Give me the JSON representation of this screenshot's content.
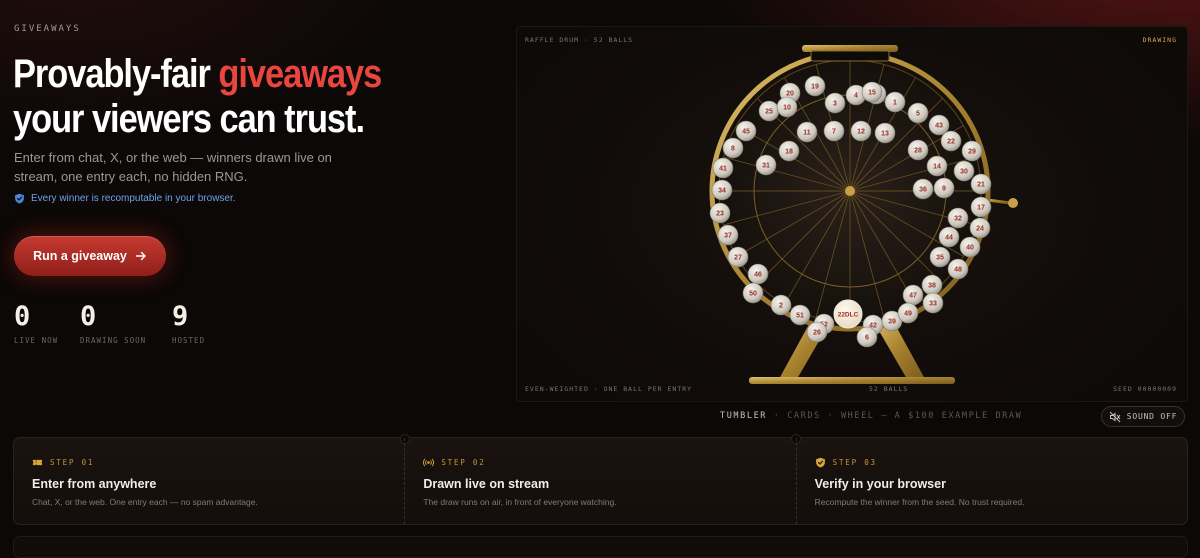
{
  "hero": {
    "eyebrow": "GIVEAWAYS",
    "headline_part1": "Provably-fair ",
    "headline_accent": "giveaways",
    "headline_part2": " your viewers can trust.",
    "subtitle": "Enter from chat, X, or the web — winners drawn live on stream, one entry each, no hidden RNG.",
    "verify_note": "Every winner is recomputable in your browser.",
    "verify_icon": "shield-check-icon",
    "cta_label": "Run a giveaway",
    "cta_icon": "arrow-right-icon",
    "stats": [
      {
        "value": "0",
        "label": "LIVE NOW"
      },
      {
        "value": "0",
        "label": "DRAWING SOON"
      },
      {
        "value": "9",
        "label": "HOSTED"
      }
    ]
  },
  "drum": {
    "top_left": "RAFFLE DRUM · 52 BALLS",
    "top_right": "DRAWING",
    "bottom_left": "EVEN-WEIGHTED · ONE BALL PER ENTRY",
    "bottom_center": "52 BALLS",
    "bottom_right": "SEED 00000009",
    "winner_label": "22DLC",
    "balls": [
      20,
      19,
      3,
      4,
      16,
      1,
      15,
      25,
      10,
      5,
      43,
      45,
      11,
      7,
      12,
      13,
      22,
      29,
      8,
      18,
      28,
      14,
      30,
      31,
      41,
      36,
      9,
      21,
      34,
      17,
      23,
      32,
      24,
      37,
      44,
      40,
      27,
      35,
      48,
      46,
      38,
      50,
      47,
      33,
      2,
      51,
      52,
      42,
      39,
      49,
      26,
      6
    ]
  },
  "modes": {
    "items": [
      "TUMBLER",
      "CARDS",
      "WHEEL"
    ],
    "active_index": 0,
    "separator": " · ",
    "suffix": " — A $100 EXAMPLE DRAW"
  },
  "sound": {
    "label": "SOUND OFF",
    "icon": "speaker-muted-icon"
  },
  "steps": [
    {
      "label": "STEP 01",
      "title": "Enter from anywhere",
      "desc": "Chat, X, or the web. One entry each — no spam advantage.",
      "icon": "ticket-icon"
    },
    {
      "label": "STEP 02",
      "title": "Drawn live on stream",
      "desc": "The draw runs on air, in front of everyone watching.",
      "icon": "broadcast-icon"
    },
    {
      "label": "STEP 03",
      "title": "Verify in your browser",
      "desc": "Recompute the winner from the seed. No trust required.",
      "icon": "shield-check-icon"
    }
  ],
  "colors": {
    "accent": "#e8463e",
    "gold": "#c9a04a",
    "link_blue": "#6fa2ea",
    "background": "#0b0807"
  }
}
